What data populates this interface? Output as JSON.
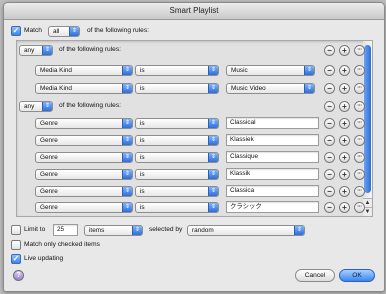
{
  "window": {
    "title": "Smart Playlist"
  },
  "match": {
    "checked": true,
    "prefix": "Match",
    "mode": "all",
    "suffix": "of the following rules:"
  },
  "groups": [
    {
      "mode": "any",
      "suffix": "of the following rules:",
      "rules": [
        {
          "field": "Media Kind",
          "operator": "is",
          "value": "Music",
          "value_type": "popup"
        },
        {
          "field": "Media Kind",
          "operator": "is",
          "value": "Music Video",
          "value_type": "popup"
        }
      ]
    },
    {
      "mode": "any",
      "suffix": "of the following rules:",
      "rules": [
        {
          "field": "Genre",
          "operator": "is",
          "value": "Classical",
          "value_type": "text"
        },
        {
          "field": "Genre",
          "operator": "is",
          "value": "Klassiek",
          "value_type": "text"
        },
        {
          "field": "Genre",
          "operator": "is",
          "value": "Classique",
          "value_type": "text"
        },
        {
          "field": "Genre",
          "operator": "is",
          "value": "Klassik",
          "value_type": "text"
        },
        {
          "field": "Genre",
          "operator": "is",
          "value": "Classica",
          "value_type": "text"
        },
        {
          "field": "Genre",
          "operator": "is",
          "value": "クラシック",
          "value_type": "text"
        }
      ]
    }
  ],
  "row_buttons": {
    "remove": "−",
    "add": "+",
    "more": "···"
  },
  "limit": {
    "checked": false,
    "label": "Limit to",
    "count": "25",
    "unit": "items",
    "selected_by_label": "selected by",
    "selected_by": "random"
  },
  "match_checked_only": {
    "checked": false,
    "label": "Match only checked items"
  },
  "live_updating": {
    "checked": true,
    "label": "Live updating"
  },
  "buttons": {
    "cancel": "Cancel",
    "ok": "OK",
    "help": "?"
  },
  "glyphs": {
    "check": "✓",
    "popup_arrow": "⇕",
    "scroll_up": "▲",
    "scroll_down": "▼"
  }
}
